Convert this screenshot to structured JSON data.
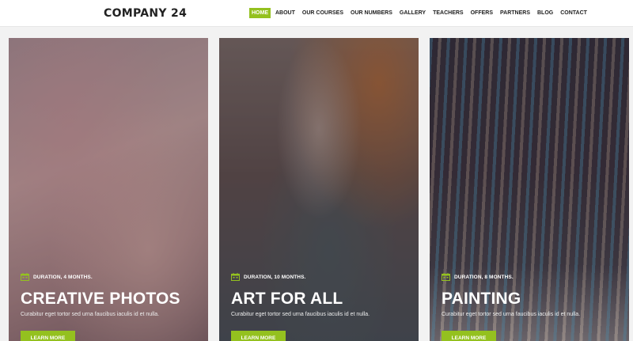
{
  "brand": {
    "logo": "COMPANY 24"
  },
  "nav": [
    {
      "label": "HOME",
      "active": true
    },
    {
      "label": "ABOUT"
    },
    {
      "label": "OUR COURSES"
    },
    {
      "label": "OUR NUMBERS"
    },
    {
      "label": "GALLERY"
    },
    {
      "label": "TEACHERS"
    },
    {
      "label": "OFFERS"
    },
    {
      "label": "PARTNERS"
    },
    {
      "label": "BLOG"
    },
    {
      "label": "CONTACT"
    }
  ],
  "courses": [
    {
      "duration": "DURATION, 4 MONTHS.",
      "title": "CREATIVE PHOTOS",
      "description": "Curabitur eget tortor sed urna faucibus iaculis id et nulla.",
      "button": "LEARN MORE"
    },
    {
      "duration": "DURATION, 10 MONTHS.",
      "title": "ART FOR ALL",
      "description": "Curabitur eget tortor sed urna faucibus iaculis id et nulla.",
      "button": "LEARN MORE"
    },
    {
      "duration": "DURATION, 8 MONTHS.",
      "title": "PAINTING",
      "description": "Curabitur eget tortor sed urna faucibus iaculis id et nulla.",
      "button": "LEARN MORE"
    }
  ],
  "colors": {
    "accent": "#94c11f"
  }
}
